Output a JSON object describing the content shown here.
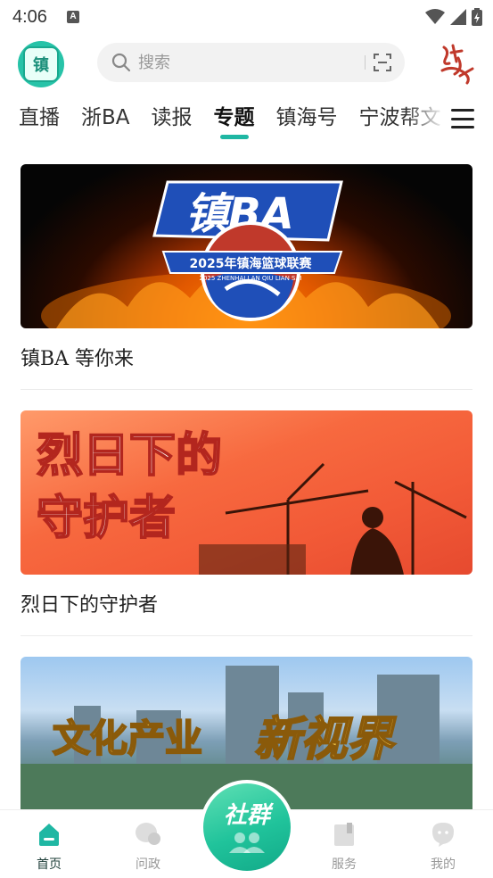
{
  "status": {
    "time": "4:06",
    "notif_badge": "A"
  },
  "header": {
    "logo_text": "镇",
    "search_placeholder": "搜索",
    "brand_text": "镇红"
  },
  "tabs": [
    "直播",
    "浙BA",
    "读报",
    "专题",
    "镇海号",
    "宁波帮文"
  ],
  "active_tab_index": 3,
  "feed": [
    {
      "banner_title": "镇BA",
      "banner_subtitle": "2025年镇海篮球联赛",
      "banner_subtitle2": "2025 ZHENHAI LAN QIU LIAN SAI",
      "caption": "镇BA  等你来"
    },
    {
      "banner_title_line1": "烈日下的",
      "banner_title_line2": "守护者",
      "caption": "烈日下的守护者"
    },
    {
      "banner_title_a": "文化产业",
      "banner_title_b": "新视界"
    }
  ],
  "bottom_nav": {
    "home": "首页",
    "wenzheng": "问政",
    "center": "社群",
    "service": "服务",
    "mine": "我的"
  },
  "colors": {
    "accent": "#1fb7a3",
    "nav_active": "#1fb7a3",
    "nav_inactive": "#999999",
    "brand_red": "#c0392b"
  },
  "icons": [
    "wifi-icon",
    "signal-icon",
    "battery-icon",
    "search-icon",
    "scan-icon",
    "menu-icon",
    "home-icon",
    "chat-icon",
    "book-icon",
    "profile-icon",
    "community-icon"
  ]
}
